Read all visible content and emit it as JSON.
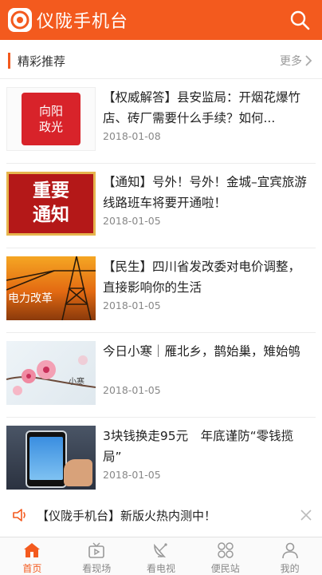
{
  "header": {
    "title": "仪陇手机台",
    "brand_color": "#f35a1e"
  },
  "section": {
    "title": "精彩推荐",
    "more_label": "更多"
  },
  "news": [
    {
      "title": "【权威解答】县安监局：开烟花爆竹店、砖厂需要什么手续？如何...",
      "date": "2018-01-08",
      "thumb_text": "向阳政光"
    },
    {
      "title": "【通知】号外！号外！金城–宜宾旅游线路班车将要开通啦！",
      "date": "2018-01-05",
      "thumb_text_1": "重要",
      "thumb_text_2": "通知"
    },
    {
      "title": "【民生】四川省发改委对电价调整，直接影响你的生活",
      "date": "2018-01-05",
      "thumb_text": "电力改革"
    },
    {
      "title": "今日小寒｜雁北乡，鹊始巢，雉始鸲",
      "date": "2018-01-05",
      "thumb_text": "小寒"
    },
    {
      "title": "3块钱换走95元　年底谨防“零钱揽局”",
      "date": "2018-01-05"
    }
  ],
  "notice": {
    "text": "【仪陇手机台】新版火热内测中！"
  },
  "tabs": [
    {
      "label": "首页",
      "icon": "home-icon",
      "active": true
    },
    {
      "label": "看现场",
      "icon": "live-camera-icon",
      "active": false
    },
    {
      "label": "看电视",
      "icon": "tv-dish-icon",
      "active": false
    },
    {
      "label": "便民站",
      "icon": "grid-services-icon",
      "active": false
    },
    {
      "label": "我的",
      "icon": "user-icon",
      "active": false
    }
  ]
}
